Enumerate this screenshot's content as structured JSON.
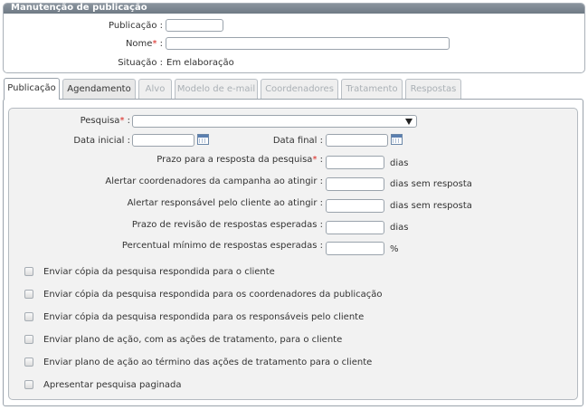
{
  "header": {
    "title": "Manutenção de publicação",
    "publicacao_label": "Publicação :",
    "publicacao_value": "",
    "nome_label": "Nome",
    "nome_suffix": ":",
    "nome_value": "",
    "situacao_label": "Situação :",
    "situacao_value": "Em elaboração"
  },
  "tabs": [
    {
      "label": "Publicação",
      "state": "active"
    },
    {
      "label": "Agendamento",
      "state": "enabled"
    },
    {
      "label": "Alvo",
      "state": "disabled"
    },
    {
      "label": "Modelo de e-mail",
      "state": "disabled"
    },
    {
      "label": "Coordenadores",
      "state": "disabled"
    },
    {
      "label": "Tratamento",
      "state": "disabled"
    },
    {
      "label": "Respostas",
      "state": "disabled"
    }
  ],
  "form": {
    "required_mark": "*",
    "pesquisa_label": "Pesquisa",
    "pesquisa_suffix": ":",
    "pesquisa_value": "",
    "data_inicial_label": "Data inicial :",
    "data_final_label": "Data final :",
    "prazo_resposta_label": "Prazo para a resposta da pesquisa",
    "prazo_resposta_suffix": ":",
    "prazo_resposta_unit": "dias",
    "alertar_coord_label": "Alertar coordenadores da campanha ao atingir :",
    "alertar_coord_unit": "dias sem resposta",
    "alertar_resp_label": "Alertar responsável pelo cliente ao atingir :",
    "alertar_resp_unit": "dias sem resposta",
    "prazo_revisao_label": "Prazo de revisão de respostas esperadas :",
    "prazo_revisao_unit": "dias",
    "percentual_label": "Percentual mínimo de respostas esperadas :",
    "percentual_unit": "%"
  },
  "checkboxes": [
    {
      "label": "Enviar cópia da pesquisa respondida para o cliente",
      "checked": false
    },
    {
      "label": "Enviar cópia da pesquisa respondida para os coordenadores da publicação",
      "checked": false
    },
    {
      "label": "Enviar cópia da pesquisa respondida para os responsáveis pelo cliente",
      "checked": false
    },
    {
      "label": "Enviar plano de ação, com as ações de tratamento, para o cliente",
      "checked": false
    },
    {
      "label": "Enviar plano de ação ao término das ações de tratamento para o cliente",
      "checked": false
    },
    {
      "label": "Apresentar pesquisa paginada",
      "checked": false
    }
  ],
  "icons": {
    "dropdown": "chevron-down-icon",
    "calendar": "calendar-icon"
  }
}
